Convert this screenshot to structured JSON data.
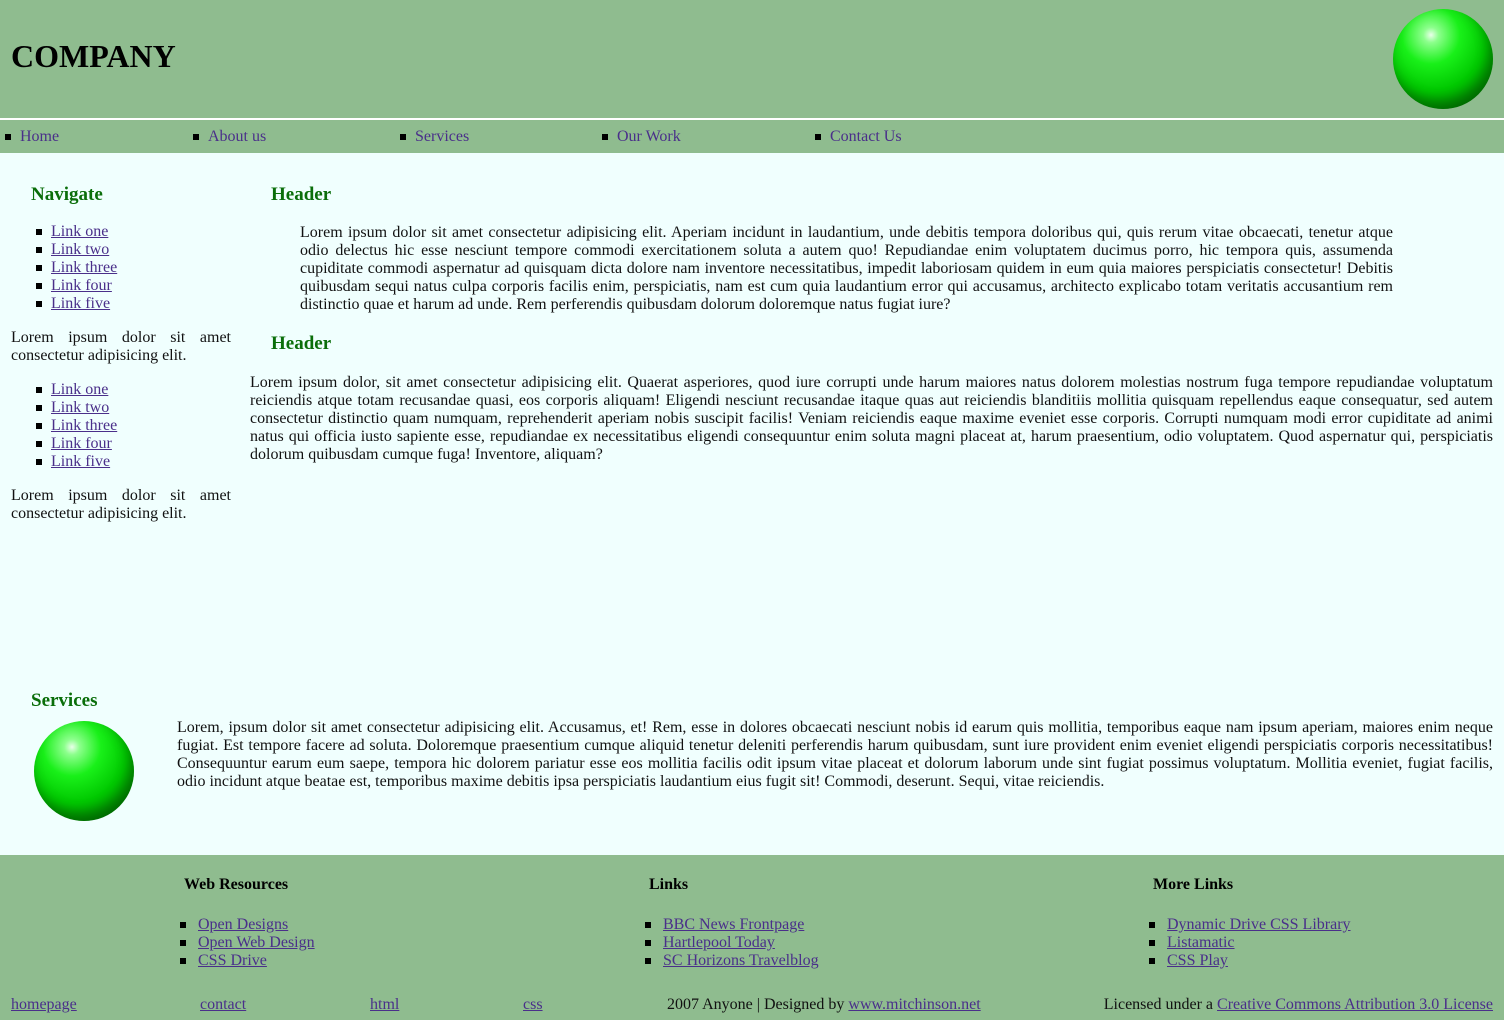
{
  "header": {
    "company": "COMPANY"
  },
  "topnav": {
    "items": [
      {
        "label": "Home"
      },
      {
        "label": "About us"
      },
      {
        "label": "Services"
      },
      {
        "label": "Our Work"
      },
      {
        "label": "Contact Us"
      }
    ]
  },
  "sidebar": {
    "title": "Navigate",
    "links1": [
      "Link one",
      "Link two",
      "Link three",
      "Link four",
      "Link five"
    ],
    "text1": "Lorem ipsum dolor sit amet consectetur adipisicing elit.",
    "links2": [
      "Link one",
      "Link two",
      "Link three",
      "Link four",
      "Link five"
    ],
    "text2": "Lorem ipsum dolor sit amet consectetur adipisicing elit."
  },
  "main": {
    "header1": "Header",
    "para1": "Lorem ipsum dolor sit amet consectetur adipisicing elit. Aperiam incidunt in laudantium, unde debitis tempora doloribus qui, quis rerum vitae obcaecati, tenetur atque odio delectus hic esse nesciunt tempore commodi exercitationem soluta a autem quo! Repudiandae enim voluptatem ducimus porro, hic tempora quis, assumenda cupiditate commodi aspernatur ad quisquam dicta dolore nam inventore necessitatibus, impedit laboriosam quidem in eum quia maiores perspiciatis consectetur! Debitis quibusdam sequi natus culpa corporis facilis enim, perspiciatis, nam est cum quia laudantium error qui accusamus, architecto explicabo totam veritatis accusantium rem distinctio quae et harum ad unde. Rem perferendis quibusdam dolorum doloremque natus fugiat iure?",
    "header2": "Header",
    "para2": "Lorem ipsum dolor, sit amet consectetur adipisicing elit. Quaerat asperiores, quod iure corrupti unde harum maiores natus dolorem molestias nostrum fuga tempore repudiandae voluptatum reiciendis atque totam recusandae quasi, eos corporis aliquam! Eligendi nesciunt recusandae itaque quas aut reiciendis blanditiis mollitia quisquam repellendus eaque consequatur, sed autem consectetur distinctio quam numquam, reprehenderit aperiam nobis suscipit facilis! Veniam reiciendis eaque maxime eveniet esse corporis. Corrupti numquam modi error cupiditate ad animi natus qui officia iusto sapiente esse, repudiandae ex necessitatibus eligendi consequuntur enim soluta magni placeat at, harum praesentium, odio voluptatem. Quod aspernatur qui, perspiciatis dolorum quibusdam cumque fuga! Inventore, aliquam?"
  },
  "services": {
    "title": "Services",
    "text": "Lorem, ipsum dolor sit amet consectetur adipisicing elit. Accusamus, et! Rem, esse in dolores obcaecati nesciunt nobis id earum quis mollitia, temporibus eaque nam ipsum aperiam, maiores enim neque fugiat. Est tempore facere ad soluta. Doloremque praesentium cumque aliquid tenetur deleniti perferendis harum quibusdam, sunt iure provident enim eveniet eligendi perspiciatis corporis necessitatibus! Consequuntur earum eum saepe, tempora hic dolorem pariatur esse eos mollitia facilis odit ipsum vitae placeat et dolorum laborum unde sint fugiat possimus voluptatum. Mollitia eveniet, fugiat facilis, odio incidunt atque beatae est, temporibus maxime debitis ipsa perspiciatis laudantium eius fugit sit! Commodi, deserunt. Sequi, vitae reiciendis."
  },
  "footer": {
    "col1": {
      "title": "Web Resources",
      "links": [
        "Open Designs",
        "Open Web Design",
        "CSS Drive"
      ]
    },
    "col2": {
      "title": "Links",
      "links": [
        "BBC News Frontpage",
        "Hartlepool Today",
        "SC Horizons Travelblog"
      ]
    },
    "col3": {
      "title": "More Links",
      "links": [
        "Dynamic Drive CSS Library",
        "Listamatic",
        "CSS Play"
      ]
    },
    "bottom": {
      "homepage": "homepage",
      "contact": "contact",
      "html": "html",
      "css": "css",
      "copyright": "2007 Anyone | Designed by",
      "designer_link": "www.mitchinson.net",
      "license_text": "Licensed under a",
      "license_link": "Creative Commons Attribution 3.0 License"
    }
  },
  "colors": {
    "band": "#8fbc8f",
    "page_bg": "#f0fffe",
    "heading": "#0a6e0a",
    "link": "#4a2f8a"
  }
}
